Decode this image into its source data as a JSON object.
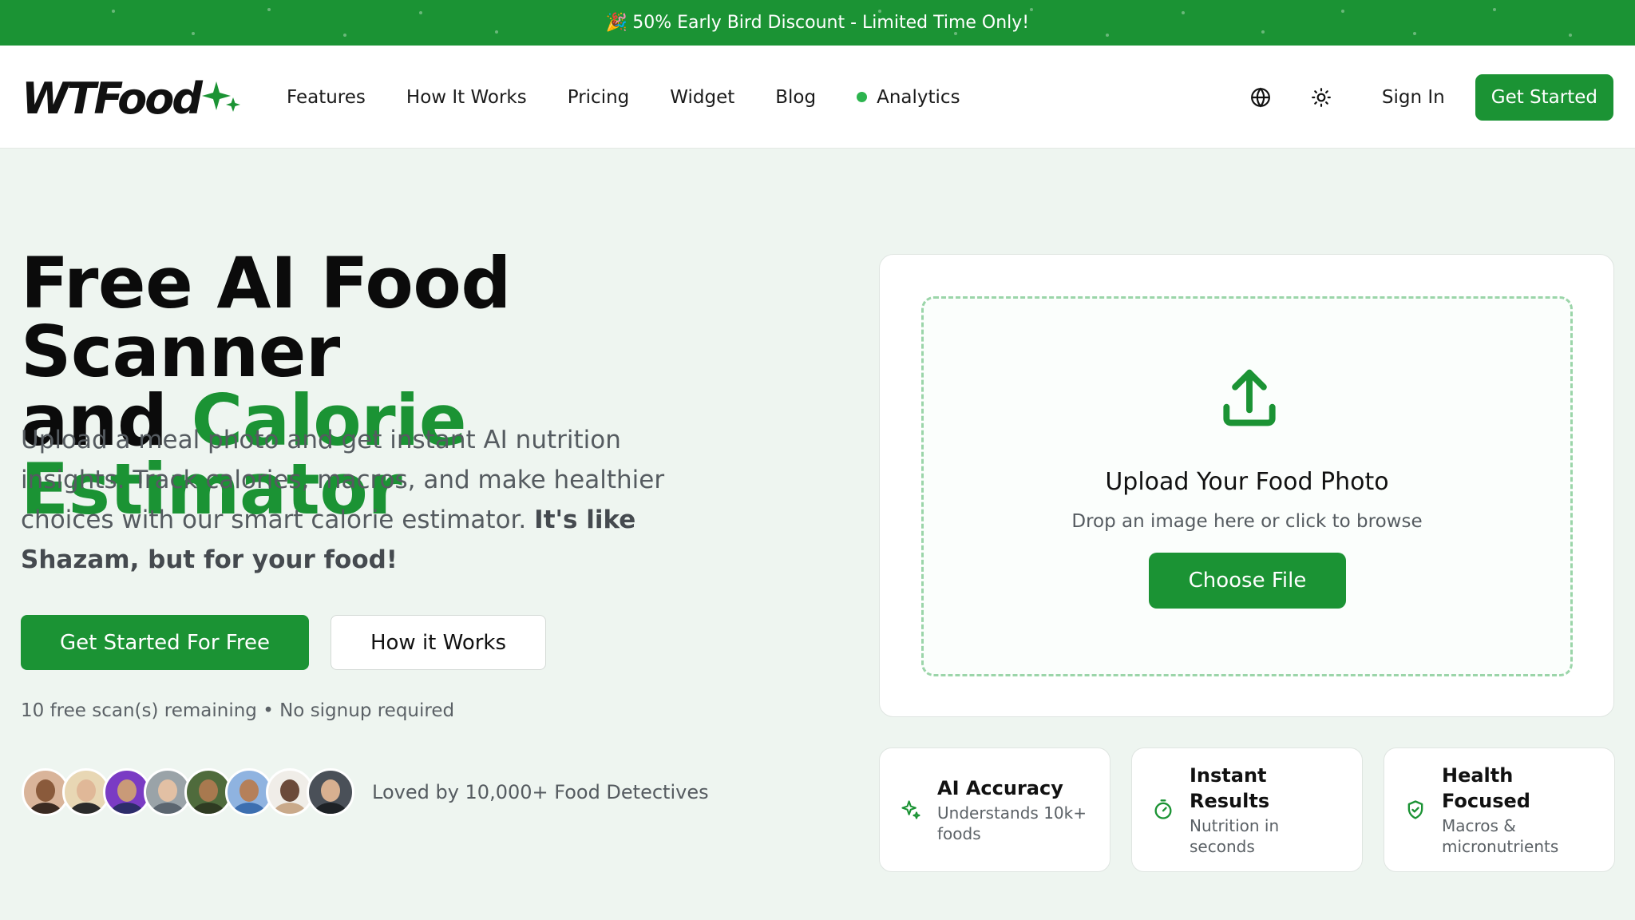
{
  "promo": {
    "emoji": "🎉",
    "text": "50% Early Bird Discount - Limited Time Only!"
  },
  "nav": {
    "logo": "WTFood",
    "links": [
      "Features",
      "How It Works",
      "Pricing",
      "Widget",
      "Blog",
      "Analytics"
    ],
    "sign_in": "Sign In",
    "cta": "Get Started",
    "icons": [
      "globe-icon",
      "sun-icon"
    ]
  },
  "hero": {
    "title_line1": "Free AI Food Scanner",
    "title_line2_prefix": "and ",
    "title_line2_accent": "Calorie Estimator",
    "subtitle": "Upload a meal photo and get instant AI nutrition insights. Track calories, macros, and make healthier choices with our smart calorie estimator. ",
    "subtitle_bold": "It's like Shazam, but for your food!",
    "primary_button": "Get Started For Free",
    "secondary_button": "How it Works",
    "scan_note": "10 free scan(s) remaining • No signup required",
    "loved_by": "Loved by 10,000+ Food Detectives"
  },
  "upload": {
    "title": "Upload Your Food Photo",
    "hint": "Drop an image here or click to browse",
    "button": "Choose File"
  },
  "features": [
    {
      "title": "AI Accuracy",
      "desc": "Understands 10k+ foods",
      "icon": "sparkles-icon"
    },
    {
      "title": "Instant Results",
      "desc": "Nutrition in seconds",
      "icon": "timer-icon"
    },
    {
      "title": "Health Focused",
      "desc": "Macros & micronutrients",
      "icon": "shield-check-icon"
    }
  ],
  "colors": {
    "brand_green": "#1b9334",
    "background": "#eef5f0",
    "text_muted": "#555b60"
  }
}
